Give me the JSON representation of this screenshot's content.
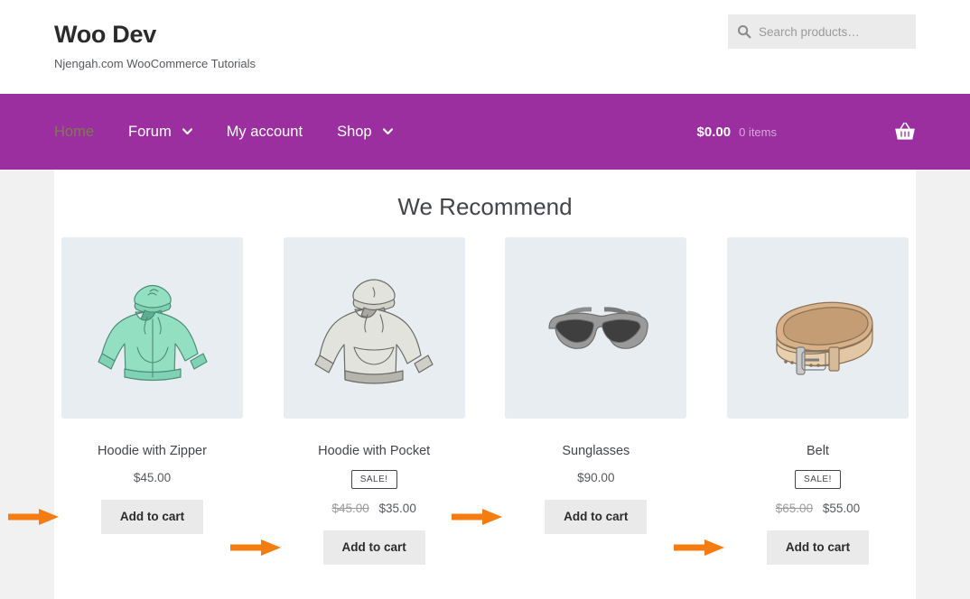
{
  "header": {
    "site_title": "Woo Dev",
    "tagline": "Njengah.com WooCommerce Tutorials",
    "search": {
      "placeholder": "Search products…",
      "value": "",
      "icon": "search-icon"
    }
  },
  "nav": {
    "items": [
      {
        "label": "Home",
        "has_dropdown": false,
        "active": true
      },
      {
        "label": "Forum",
        "has_dropdown": true,
        "active": false
      },
      {
        "label": "My account",
        "has_dropdown": false,
        "active": false
      },
      {
        "label": "Shop",
        "has_dropdown": true,
        "active": false
      }
    ],
    "cart": {
      "total": "$0.00",
      "count": "0 items",
      "icon": "shopping-basket-icon"
    },
    "background_color": "#9b2fa0"
  },
  "main": {
    "section_title": "We Recommend",
    "add_to_cart_label": "Add to cart",
    "sale_label": "SALE!",
    "annotation_color": "#f57c11",
    "products": [
      {
        "name": "Hoodie with Zipper",
        "image": "zip-hoodie-image",
        "on_sale": false,
        "price": "$45.00",
        "regular_price": "",
        "sale_price": "",
        "button_label": "Add to cart",
        "annotated": true
      },
      {
        "name": "Hoodie with Pocket",
        "image": "pullover-hoodie-image",
        "on_sale": true,
        "price": "",
        "regular_price": "$45.00",
        "sale_price": "$35.00",
        "button_label": "Add to cart",
        "annotated": true
      },
      {
        "name": "Sunglasses",
        "image": "sunglasses-image",
        "on_sale": false,
        "price": "$90.00",
        "regular_price": "",
        "sale_price": "",
        "button_label": "Add to cart",
        "annotated": true
      },
      {
        "name": "Belt",
        "image": "belt-image",
        "on_sale": true,
        "price": "",
        "regular_price": "$65.00",
        "sale_price": "$55.00",
        "button_label": "Add to cart",
        "annotated": true
      }
    ]
  }
}
